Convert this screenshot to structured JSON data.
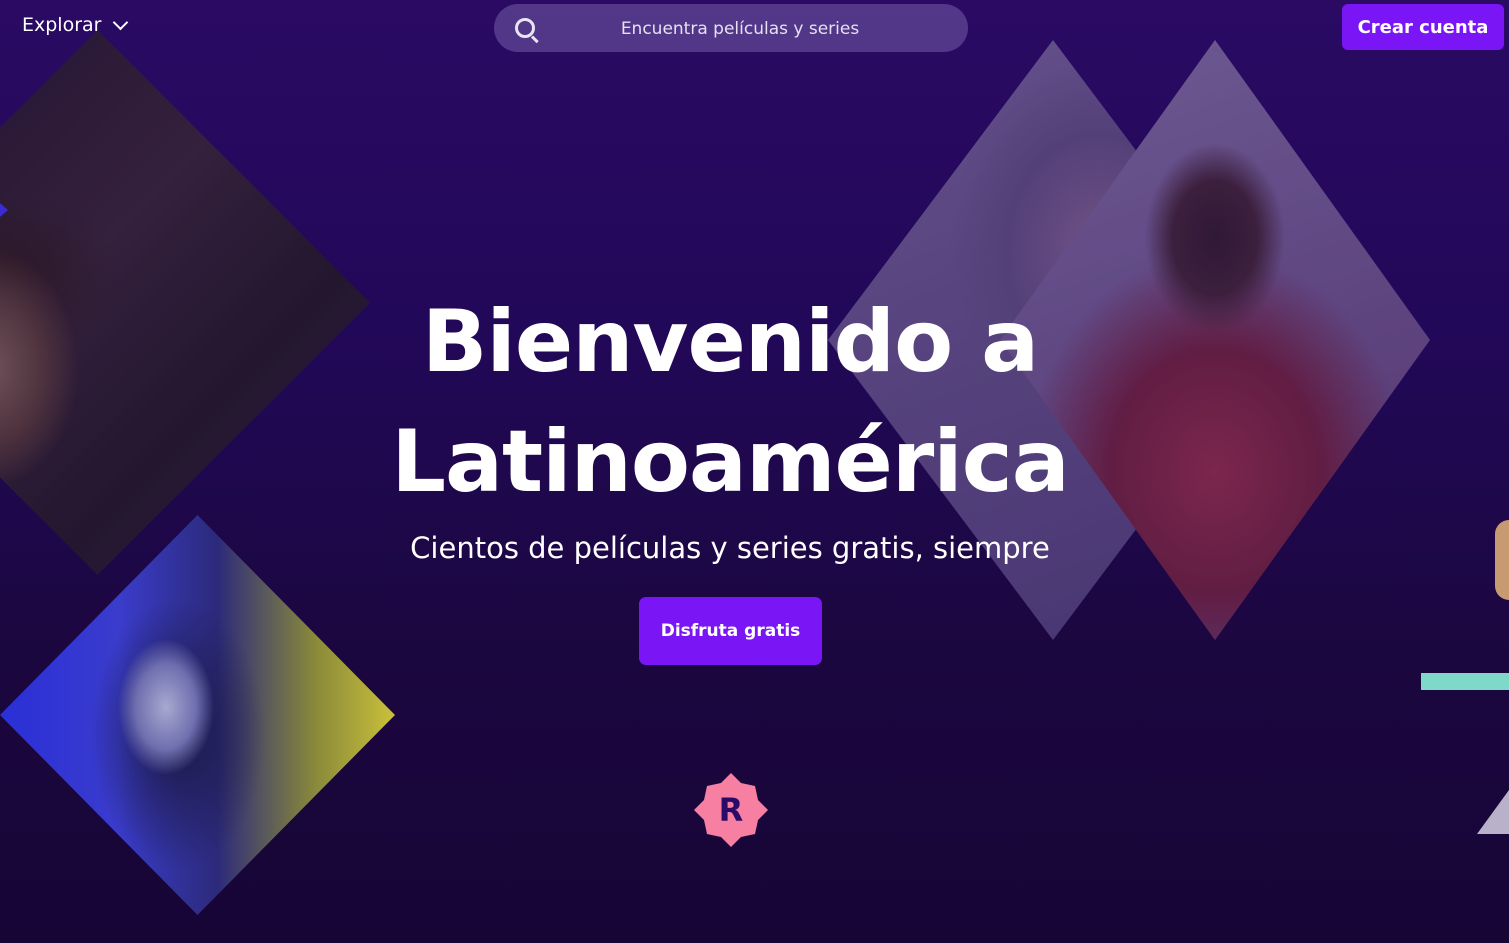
{
  "nav": {
    "explore_label": "Explorar",
    "search_placeholder": "Encuentra películas y series",
    "create_account_label": "Crear cuenta"
  },
  "hero": {
    "title_line1": "Bienvenido a",
    "title_line2": "Latinoamérica",
    "subtitle": "Cientos de películas y series gratis, siempre",
    "cta_label": "Disfruta gratis"
  },
  "logo": {
    "letter": "R",
    "color": "#f77fa2"
  },
  "icons": {
    "explore_chevron": "chevron-down-icon",
    "search": "search-icon"
  },
  "colors": {
    "primary_button": "#7a16f5",
    "accent_teal": "#7fd9c8",
    "background": "#220858"
  }
}
